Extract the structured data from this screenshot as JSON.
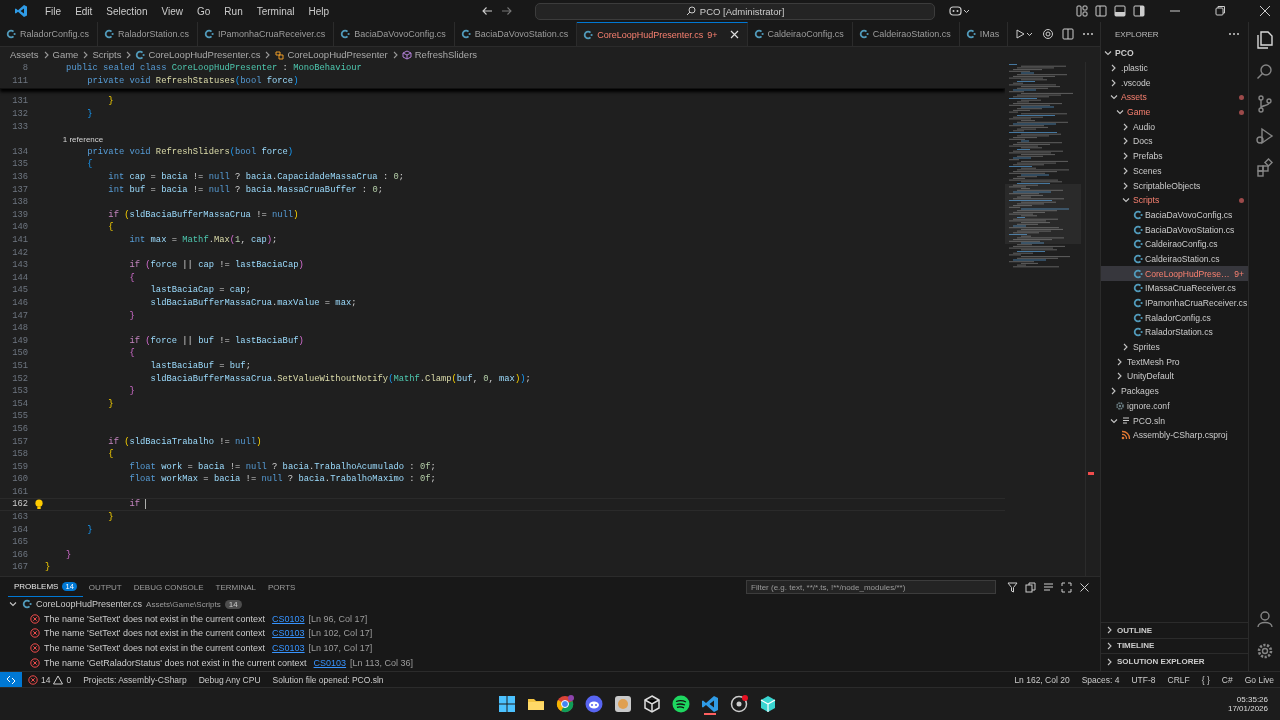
{
  "title_bar": {
    "menu": [
      "File",
      "Edit",
      "Selection",
      "View",
      "Go",
      "Run",
      "Terminal",
      "Help"
    ],
    "search": "PCO [Administrator]"
  },
  "tabs": [
    {
      "label": "RaladorConfig.cs",
      "selected": false
    },
    {
      "label": "RaladorStation.cs",
      "selected": false
    },
    {
      "label": "IPamonhaCruaReceiver.cs",
      "selected": false
    },
    {
      "label": "BaciaDaVovoConfig.cs",
      "selected": false
    },
    {
      "label": "BaciaDaVovoStation.cs",
      "selected": false
    },
    {
      "label": "CoreLoopHudPresenter.cs",
      "selected": true,
      "badge": "9+"
    },
    {
      "label": "CaldeiraoConfig.cs",
      "selected": false
    },
    {
      "label": "CaldeiraoStation.cs",
      "selected": false
    },
    {
      "label": "IMas",
      "selected": false
    }
  ],
  "breadcrumb": [
    {
      "label": "Assets",
      "kind": "folder"
    },
    {
      "label": "Game",
      "kind": "folder"
    },
    {
      "label": "Scripts",
      "kind": "folder"
    },
    {
      "label": "CoreLoopHudPresenter.cs",
      "kind": "file"
    },
    {
      "label": "CoreLoopHudPresenter",
      "kind": "class"
    },
    {
      "label": "RefreshSliders",
      "kind": "method"
    }
  ],
  "editor": {
    "sticky": [
      {
        "n": "8",
        "t": [
          {
            "text": "    public sealed class ",
            "kind": "kw"
          },
          {
            "text": "CoreLoopHudPresenter",
            "kind": "type"
          },
          {
            "text": " : ",
            "kind": "op"
          },
          {
            "text": "MonoBehaviour",
            "kind": "type"
          }
        ]
      },
      {
        "n": "111",
        "t": [
          {
            "text": "        private void ",
            "kind": "kw"
          },
          {
            "text": "RefreshStatuses",
            "kind": "fn"
          },
          {
            "text": "(",
            "kind": "br3"
          },
          {
            "text": "bool ",
            "kind": "kw"
          },
          {
            "text": "force",
            "kind": "var"
          },
          {
            "text": ")",
            "kind": "br3"
          }
        ]
      }
    ],
    "lines": [
      {
        "n": "131",
        "t": [
          {
            "text": "            }",
            "kind": "br1"
          }
        ]
      },
      {
        "n": "132",
        "t": [
          {
            "text": "        }",
            "kind": "br3"
          }
        ]
      },
      {
        "n": "133"
      },
      {
        "kind": "lens",
        "t": [
          {
            "text": "        1 reference",
            "kind": "op"
          }
        ]
      },
      {
        "n": "134",
        "t": [
          {
            "text": "        private void ",
            "kind": "kw"
          },
          {
            "text": "RefreshSliders",
            "kind": "fn"
          },
          {
            "text": "(",
            "kind": "br3"
          },
          {
            "text": "bool ",
            "kind": "kw"
          },
          {
            "text": "force",
            "kind": "var"
          },
          {
            "text": ")",
            "kind": "br3"
          }
        ]
      },
      {
        "n": "135",
        "t": [
          {
            "text": "        {",
            "kind": "br3"
          }
        ]
      },
      {
        "n": "136",
        "t": [
          {
            "text": "            int ",
            "kind": "kw"
          },
          {
            "text": "cap",
            "kind": "var"
          },
          {
            "text": " = ",
            "kind": "op"
          },
          {
            "text": "bacia",
            "kind": "var"
          },
          {
            "text": " != ",
            "kind": "op"
          },
          {
            "text": "null",
            "kind": "kw"
          },
          {
            "text": " ? ",
            "kind": "op"
          },
          {
            "text": "bacia",
            "kind": "var"
          },
          {
            "text": ".",
            "kind": "op"
          },
          {
            "text": "CapacidadeMassaCrua",
            "kind": "var"
          },
          {
            "text": " : ",
            "kind": "op"
          },
          {
            "text": "0",
            "kind": "num"
          },
          {
            "text": ";",
            "kind": "op"
          }
        ]
      },
      {
        "n": "137",
        "t": [
          {
            "text": "            int ",
            "kind": "kw"
          },
          {
            "text": "buf",
            "kind": "var"
          },
          {
            "text": " = ",
            "kind": "op"
          },
          {
            "text": "bacia",
            "kind": "var"
          },
          {
            "text": " != ",
            "kind": "op"
          },
          {
            "text": "null",
            "kind": "kw"
          },
          {
            "text": " ? ",
            "kind": "op"
          },
          {
            "text": "bacia",
            "kind": "var"
          },
          {
            "text": ".",
            "kind": "op"
          },
          {
            "text": "MassaCruaBuffer",
            "kind": "var"
          },
          {
            "text": " : ",
            "kind": "op"
          },
          {
            "text": "0",
            "kind": "num"
          },
          {
            "text": ";",
            "kind": "op"
          }
        ]
      },
      {
        "n": "138"
      },
      {
        "n": "139",
        "t": [
          {
            "text": "            if ",
            "kind": "ctl"
          },
          {
            "text": "(",
            "kind": "br1"
          },
          {
            "text": "sldBaciaBufferMassaCrua",
            "kind": "var"
          },
          {
            "text": " != ",
            "kind": "op"
          },
          {
            "text": "null",
            "kind": "kw"
          },
          {
            "text": ")",
            "kind": "br1"
          }
        ]
      },
      {
        "n": "140",
        "t": [
          {
            "text": "            {",
            "kind": "br1"
          }
        ]
      },
      {
        "n": "141",
        "t": [
          {
            "text": "                int ",
            "kind": "kw"
          },
          {
            "text": "max",
            "kind": "var"
          },
          {
            "text": " = ",
            "kind": "op"
          },
          {
            "text": "Mathf",
            "kind": "type"
          },
          {
            "text": ".",
            "kind": "op"
          },
          {
            "text": "Max",
            "kind": "fn"
          },
          {
            "text": "(",
            "kind": "br2"
          },
          {
            "text": "1",
            "kind": "num"
          },
          {
            "text": ", ",
            "kind": "op"
          },
          {
            "text": "cap",
            "kind": "var"
          },
          {
            "text": ")",
            "kind": "br2"
          },
          {
            "text": ";",
            "kind": "op"
          }
        ]
      },
      {
        "n": "142"
      },
      {
        "n": "143",
        "t": [
          {
            "text": "                if ",
            "kind": "ctl"
          },
          {
            "text": "(",
            "kind": "br2"
          },
          {
            "text": "force",
            "kind": "var"
          },
          {
            "text": " || ",
            "kind": "op"
          },
          {
            "text": "cap",
            "kind": "var"
          },
          {
            "text": " != ",
            "kind": "op"
          },
          {
            "text": "lastBaciaCap",
            "kind": "var"
          },
          {
            "text": ")",
            "kind": "br2"
          }
        ]
      },
      {
        "n": "144",
        "t": [
          {
            "text": "                {",
            "kind": "br2"
          }
        ]
      },
      {
        "n": "145",
        "t": [
          {
            "text": "                    lastBaciaCap",
            "kind": "var"
          },
          {
            "text": " = ",
            "kind": "op"
          },
          {
            "text": "cap",
            "kind": "var"
          },
          {
            "text": ";",
            "kind": "op"
          }
        ]
      },
      {
        "n": "146",
        "t": [
          {
            "text": "                    sldBaciaBufferMassaCrua",
            "kind": "var"
          },
          {
            "text": ".",
            "kind": "op"
          },
          {
            "text": "maxValue",
            "kind": "var"
          },
          {
            "text": " = ",
            "kind": "op"
          },
          {
            "text": "max",
            "kind": "var"
          },
          {
            "text": ";",
            "kind": "op"
          }
        ]
      },
      {
        "n": "147",
        "t": [
          {
            "text": "                }",
            "kind": "br2"
          }
        ]
      },
      {
        "n": "148"
      },
      {
        "n": "149",
        "t": [
          {
            "text": "                if ",
            "kind": "ctl"
          },
          {
            "text": "(",
            "kind": "br2"
          },
          {
            "text": "force",
            "kind": "var"
          },
          {
            "text": " || ",
            "kind": "op"
          },
          {
            "text": "buf",
            "kind": "var"
          },
          {
            "text": " != ",
            "kind": "op"
          },
          {
            "text": "lastBaciaBuf",
            "kind": "var"
          },
          {
            "text": ")",
            "kind": "br2"
          }
        ]
      },
      {
        "n": "150",
        "t": [
          {
            "text": "                {",
            "kind": "br2"
          }
        ]
      },
      {
        "n": "151",
        "t": [
          {
            "text": "                    lastBaciaBuf",
            "kind": "var"
          },
          {
            "text": " = ",
            "kind": "op"
          },
          {
            "text": "buf",
            "kind": "var"
          },
          {
            "text": ";",
            "kind": "op"
          }
        ]
      },
      {
        "n": "152",
        "t": [
          {
            "text": "                    sldBaciaBufferMassaCrua",
            "kind": "var"
          },
          {
            "text": ".",
            "kind": "op"
          },
          {
            "text": "SetValueWithoutNotify",
            "kind": "fn"
          },
          {
            "text": "(",
            "kind": "br3"
          },
          {
            "text": "Mathf",
            "kind": "type"
          },
          {
            "text": ".",
            "kind": "op"
          },
          {
            "text": "Clamp",
            "kind": "fn"
          },
          {
            "text": "(",
            "kind": "br1"
          },
          {
            "text": "buf",
            "kind": "var"
          },
          {
            "text": ", ",
            "kind": "op"
          },
          {
            "text": "0",
            "kind": "num"
          },
          {
            "text": ", ",
            "kind": "op"
          },
          {
            "text": "max",
            "kind": "var"
          },
          {
            "text": ")",
            "kind": "br1"
          },
          {
            "text": ")",
            "kind": "br3"
          },
          {
            "text": ";",
            "kind": "op"
          }
        ]
      },
      {
        "n": "153",
        "t": [
          {
            "text": "                }",
            "kind": "br2"
          }
        ]
      },
      {
        "n": "154",
        "t": [
          {
            "text": "            }",
            "kind": "br1"
          }
        ]
      },
      {
        "n": "155"
      },
      {
        "n": "156"
      },
      {
        "n": "157",
        "t": [
          {
            "text": "            if ",
            "kind": "ctl"
          },
          {
            "text": "(",
            "kind": "br1"
          },
          {
            "text": "sldBaciaTrabalho",
            "kind": "var"
          },
          {
            "text": " != ",
            "kind": "op"
          },
          {
            "text": "null",
            "kind": "kw"
          },
          {
            "text": ")",
            "kind": "br1"
          }
        ]
      },
      {
        "n": "158",
        "t": [
          {
            "text": "            {",
            "kind": "br1"
          }
        ]
      },
      {
        "n": "159",
        "t": [
          {
            "text": "                float ",
            "kind": "kw"
          },
          {
            "text": "work",
            "kind": "var"
          },
          {
            "text": " = ",
            "kind": "op"
          },
          {
            "text": "bacia",
            "kind": "var"
          },
          {
            "text": " != ",
            "kind": "op"
          },
          {
            "text": "null",
            "kind": "kw"
          },
          {
            "text": " ? ",
            "kind": "op"
          },
          {
            "text": "bacia",
            "kind": "var"
          },
          {
            "text": ".",
            "kind": "op"
          },
          {
            "text": "TrabalhoAcumulado",
            "kind": "var"
          },
          {
            "text": " : ",
            "kind": "op"
          },
          {
            "text": "0f",
            "kind": "num"
          },
          {
            "text": ";",
            "kind": "op"
          }
        ]
      },
      {
        "n": "160",
        "t": [
          {
            "text": "                float ",
            "kind": "kw"
          },
          {
            "text": "workMax",
            "kind": "var"
          },
          {
            "text": " = ",
            "kind": "op"
          },
          {
            "text": "bacia",
            "kind": "var"
          },
          {
            "text": " != ",
            "kind": "op"
          },
          {
            "text": "null",
            "kind": "kw"
          },
          {
            "text": " ? ",
            "kind": "op"
          },
          {
            "text": "bacia",
            "kind": "var"
          },
          {
            "text": ".",
            "kind": "op"
          },
          {
            "text": "TrabalhoMaximo",
            "kind": "var"
          },
          {
            "text": " : ",
            "kind": "op"
          },
          {
            "text": "0f",
            "kind": "num"
          },
          {
            "text": ";",
            "kind": "op"
          }
        ]
      },
      {
        "n": "161"
      },
      {
        "n": "162",
        "current": true,
        "hint": true,
        "t": [
          {
            "text": "                if ",
            "kind": "ctl"
          }
        ]
      },
      {
        "n": "163",
        "t": [
          {
            "text": "            }",
            "kind": "br1"
          }
        ]
      },
      {
        "n": "164",
        "t": [
          {
            "text": "        }",
            "kind": "br3"
          }
        ]
      },
      {
        "n": "165"
      },
      {
        "n": "166",
        "t": [
          {
            "text": "    }",
            "kind": "br2"
          }
        ]
      },
      {
        "n": "167",
        "t": [
          {
            "text": "}",
            "kind": "br1"
          }
        ]
      }
    ]
  },
  "panel": {
    "tabs": [
      {
        "label": "PROBLEMS",
        "badge": "14",
        "selected": true
      },
      {
        "label": "OUTPUT",
        "selected": false
      },
      {
        "label": "DEBUG CONSOLE",
        "selected": false
      },
      {
        "label": "TERMINAL",
        "selected": false
      },
      {
        "label": "PORTS",
        "selected": false
      }
    ],
    "filter_placeholder": "Filter (e.g. text, **/*.ts, !**/node_modules/**)",
    "file": {
      "name": "CoreLoopHudPresenter.cs",
      "path": "Assets\\Game\\Scripts",
      "count": "14",
      "expanded": true
    },
    "problems": [
      {
        "message": "The name 'SetText' does not exist in the current context",
        "code": "CS0103",
        "location": "[Ln 96, Col 17]"
      },
      {
        "message": "The name 'SetText' does not exist in the current context",
        "code": "CS0103",
        "location": "[Ln 102, Col 17]"
      },
      {
        "message": "The name 'SetText' does not exist in the current context",
        "code": "CS0103",
        "location": "[Ln 107, Col 17]"
      },
      {
        "message": "The name 'GetRaladorStatus' does not exist in the current context",
        "code": "CS0103",
        "location": "[Ln 113, Col 36]"
      }
    ]
  },
  "explorer": {
    "title": "EXPLORER",
    "tree": [
      {
        "name": "PCO",
        "kind": "root",
        "expanded": true,
        "selected": false,
        "children": [
          {
            "name": ".plastic",
            "expanded": false,
            "selected": false
          },
          {
            "name": ".vscode",
            "expanded": false,
            "selected": false
          },
          {
            "name": "Assets",
            "expanded": true,
            "selected": false,
            "modified": true,
            "children": [
              {
                "name": "Game",
                "expanded": true,
                "selected": false,
                "modified": true,
                "children": [
                  {
                    "name": "Audio",
                    "expanded": false,
                    "selected": false
                  },
                  {
                    "name": "Docs",
                    "expanded": false,
                    "selected": false
                  },
                  {
                    "name": "Prefabs",
                    "expanded": false,
                    "selected": false
                  },
                  {
                    "name": "Scenes",
                    "expanded": false,
                    "selected": false
                  },
                  {
                    "name": "ScriptableObjects",
                    "expanded": false,
                    "selected": false
                  },
                  {
                    "name": "Scripts",
                    "expanded": true,
                    "selected": false,
                    "modified": true,
                    "children": [
                      {
                        "name": "BaciaDaVovoConfig.cs",
                        "kind": "cs",
                        "selected": false
                      },
                      {
                        "name": "BaciaDaVovoStation.cs",
                        "kind": "cs",
                        "selected": false
                      },
                      {
                        "name": "CaldeiraoConfig.cs",
                        "kind": "cs",
                        "selected": false
                      },
                      {
                        "name": "CaldeiraoStation.cs",
                        "kind": "cs",
                        "selected": false
                      },
                      {
                        "name": "CoreLoopHudPrese…",
                        "kind": "cs",
                        "selected": true,
                        "badge": "9+"
                      },
                      {
                        "name": "IMassaCruaReceiver.cs",
                        "kind": "cs",
                        "selected": false
                      },
                      {
                        "name": "IPamonhaCruaReceiver.cs",
                        "kind": "cs",
                        "selected": false
                      },
                      {
                        "name": "RaladorConfig.cs",
                        "kind": "cs",
                        "selected": false
                      },
                      {
                        "name": "RaladorStation.cs",
                        "kind": "cs",
                        "selected": false
                      }
                    ]
                  },
                  {
                    "name": "Sprites",
                    "expanded": false,
                    "selected": false
                  }
                ]
              },
              {
                "name": "TextMesh Pro",
                "expanded": false,
                "selected": false
              },
              {
                "name": "UnityDefault",
                "expanded": false,
                "selected": false
              }
            ]
          },
          {
            "name": "Packages",
            "expanded": false,
            "selected": false
          },
          {
            "name": "ignore.conf",
            "kind": "conf",
            "selected": false
          },
          {
            "name": "PCO.sln",
            "kind": "sln",
            "expanded": true,
            "selected": false,
            "children": [
              {
                "name": "Assembly-CSharp.csproj",
                "kind": "csproj",
                "selected": false
              }
            ]
          }
        ]
      }
    ]
  },
  "sections": [
    {
      "label": "OUTLINE",
      "expanded": false
    },
    {
      "label": "TIMELINE",
      "expanded": false
    },
    {
      "label": "SOLUTION EXPLORER",
      "expanded": false
    }
  ],
  "status_bar": {
    "errors": "14",
    "warnings": "0",
    "left": [
      "Projects: Assembly-CSharp",
      "Debug Any CPU",
      "Solution file opened: PCO.sln"
    ],
    "right": [
      "Ln 162, Col 20",
      "Spaces: 4",
      "UTF-8",
      "CRLF",
      "{ }",
      "C#",
      "Go Live"
    ]
  },
  "taskbar": {
    "time": "05:35:26",
    "date": "17/01/2026"
  }
}
